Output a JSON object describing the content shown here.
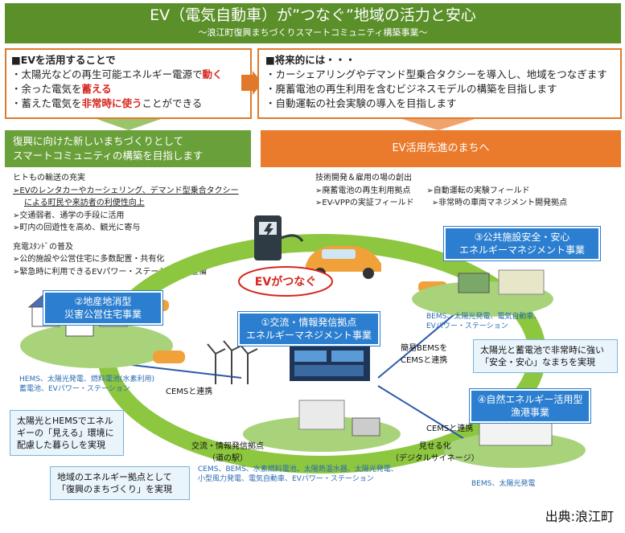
{
  "banner": {
    "title": "EV（電気自動車）が”つなぐ”地域の活力と安心",
    "subtitle": "～浪江町復興まちづくりスマートコミュニティ構築事業～"
  },
  "left_box": {
    "head": "■EVを活用することで",
    "l1a": "・太陽光などの再生可能エネルギー電源で",
    "l1b": "動く",
    "l2a": "・余った電気を",
    "l2b": "蓄える",
    "l3a": "・蓄えた電気を",
    "l3b": "非常時に使う",
    "l3c": "ことができる"
  },
  "right_box": {
    "head": "■将来的には・・・",
    "l1": "・カーシェアリングやデマンド型乗合タクシーを導入し、地域をつなぎます",
    "l2": "・廃蓄電池の再生利用を含むビジネスモデルの構築を目指します",
    "l3": "・自動運転の社会実験の導入を目指します"
  },
  "green_bar": {
    "l1": "復興に向けた新しいまちづくりとして",
    "l2": "スマートコミュニティの構築を目指します"
  },
  "orange_bar": "EV活用先進のまちへ",
  "mobility": {
    "head": "ヒトもの輸送の充実",
    "b1": "➢EVのレンタカーやカーシェリング、デマンド型乗合タクシー",
    "b1b": "による町民や来訪者の利便性向上",
    "b2": "➢交通弱者、通学の手段に活用",
    "b3": "➢町内の回遊性を高め、観光に寄与",
    "head2": "充電ｽﾀﾝﾄﾞの普及",
    "b4": "➢公的施設や公営住宅に多数配置・共有化",
    "b5": "➢緊急時に利用できるEVパワー・ステーションの整備"
  },
  "tech": {
    "head": "技術開発＆雇用の場の創出",
    "b1": "➢廃蓄電池の再生利用拠点",
    "b2": "➢EV-VPPの実証フィールド",
    "b3": "➢自動運転の実験フィールド",
    "b4": "➢非常時の車両マネジメント開発拠点"
  },
  "center_label": "EVがつなぐ",
  "proj1": {
    "l1": "①交流・情報発信拠点",
    "l2": "エネルギーマネジメント事業"
  },
  "proj2": {
    "l1": "②地産地消型",
    "l2": "災害公営住宅事業"
  },
  "proj3": {
    "l1": "③公共施設安全・安心",
    "l2": "エネルギーマネジメント事業"
  },
  "proj4": {
    "l1": "④自然エネルギー活用型",
    "l2": "漁港事業"
  },
  "eq2": {
    "l1": "HEMS、太陽光発電、燃料電池(水素利用)",
    "l2": "蓄電池、EVパワー・ステーション"
  },
  "eq3": {
    "l1": "BEMS、太陽光発電、電気自動車、",
    "l2": "EVパワー・ステーション"
  },
  "eq4": "BEMS、太陽光発電",
  "eq1": {
    "l1": "CEMS、BEMS、水素燃料電池、太陽熱温水器、太陽光発電、",
    "l2": "小型風力発電、電気自動車、EVパワー・ステーション"
  },
  "bems_link": {
    "l1": "簡易BEMSを",
    "l2": "CEMSと連携"
  },
  "cems_left": "CEMSと連携",
  "cems_right": "CEMSと連携",
  "station": {
    "l1": "交流・情報発信拠点",
    "l2": "（道の駅）"
  },
  "visual": {
    "l1": "見せる化",
    "l2": "（デジタルサイネージ）"
  },
  "cap_left": {
    "l1": "太陽光とHEMSでエネル",
    "l2": "ギーの「見える」環境に",
    "l3": "配慮した暮らしを実現"
  },
  "cap_right": {
    "l1": "太陽光と蓄電池で非常時に強い",
    "l2": "「安全・安心」なまちを実現"
  },
  "cap_bottom": {
    "l1": "地域のエネルギー拠点として",
    "l2": "「復興のまちづくり」を実現"
  },
  "source": "出典:浪江町",
  "colors": {
    "green": "#5b8f2a",
    "orange": "#ea7b2d",
    "ring": "#8dc63f",
    "blue": "#2c7fd0",
    "red": "#d7261e"
  }
}
